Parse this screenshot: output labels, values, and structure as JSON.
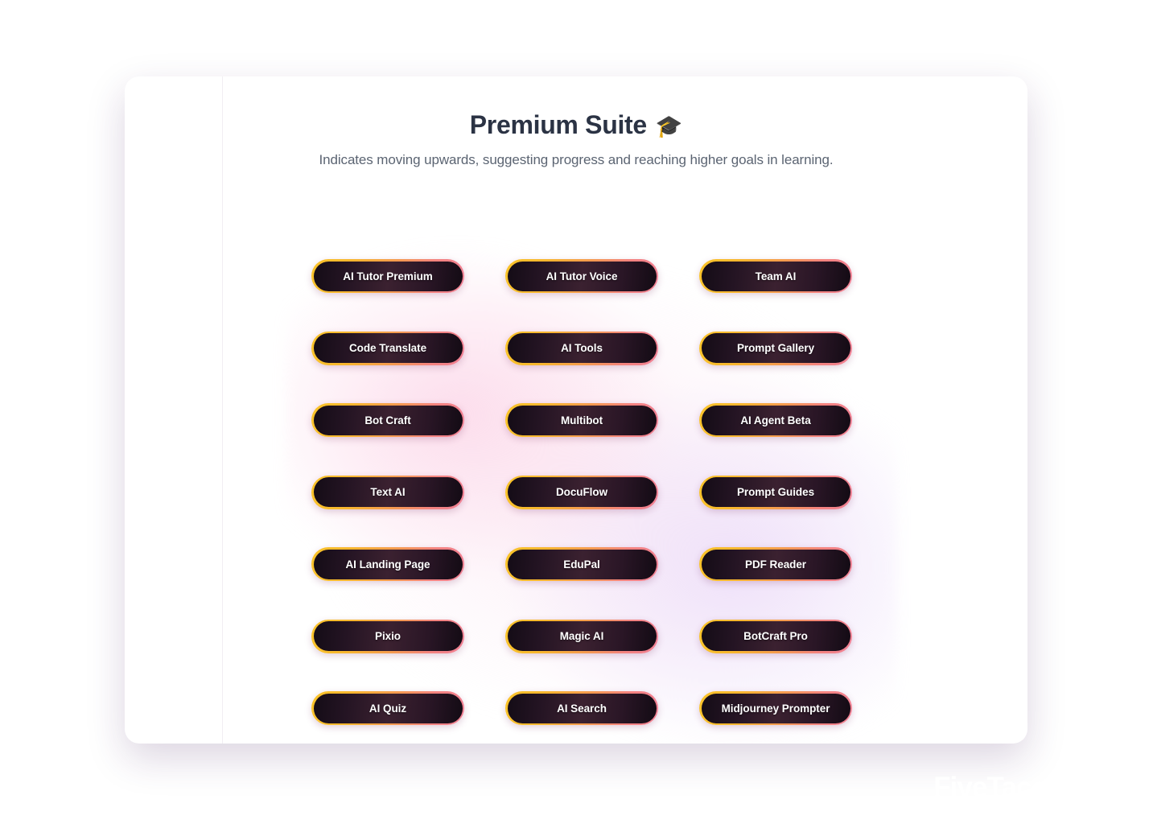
{
  "header": {
    "title": "Premium Suite",
    "cap_icon": "🎓",
    "subtitle": "Indicates moving upwards, suggesting progress and reaching higher goals in learning."
  },
  "brand": {
    "name": "FiveTaco"
  },
  "grid": {
    "columns": 3,
    "buttons": [
      {
        "label": "AI Tutor Premium"
      },
      {
        "label": "AI Tutor Voice"
      },
      {
        "label": "Team AI"
      },
      {
        "label": "Code Translate"
      },
      {
        "label": "AI Tools"
      },
      {
        "label": "Prompt Gallery"
      },
      {
        "label": "Bot Craft"
      },
      {
        "label": "Multibot"
      },
      {
        "label": "AI Agent Beta"
      },
      {
        "label": "Text AI"
      },
      {
        "label": "DocuFlow"
      },
      {
        "label": "Prompt Guides"
      },
      {
        "label": "AI Landing Page"
      },
      {
        "label": "EduPal"
      },
      {
        "label": "PDF Reader"
      },
      {
        "label": "Pixio"
      },
      {
        "label": "Magic AI"
      },
      {
        "label": "BotCraft Pro"
      },
      {
        "label": "AI Quiz"
      },
      {
        "label": "AI Search"
      },
      {
        "label": "Midjourney Prompter"
      }
    ]
  },
  "colors": {
    "background_top_left": "#ec6ab8",
    "background_top_right": "#a760e2",
    "background_bottom_left": "#7d52f3",
    "background_bottom_right": "#8457f1",
    "card": "#ffffff",
    "title_text": "#2b3344",
    "subtitle_text": "#5b6472",
    "button_border_start": "#f9c42a",
    "button_border_end": "#f08095",
    "button_fill_dark": "#140c16",
    "button_fill_mid": "#3b2130",
    "button_label": "#ffffff",
    "brand_text": "#ffffff"
  }
}
